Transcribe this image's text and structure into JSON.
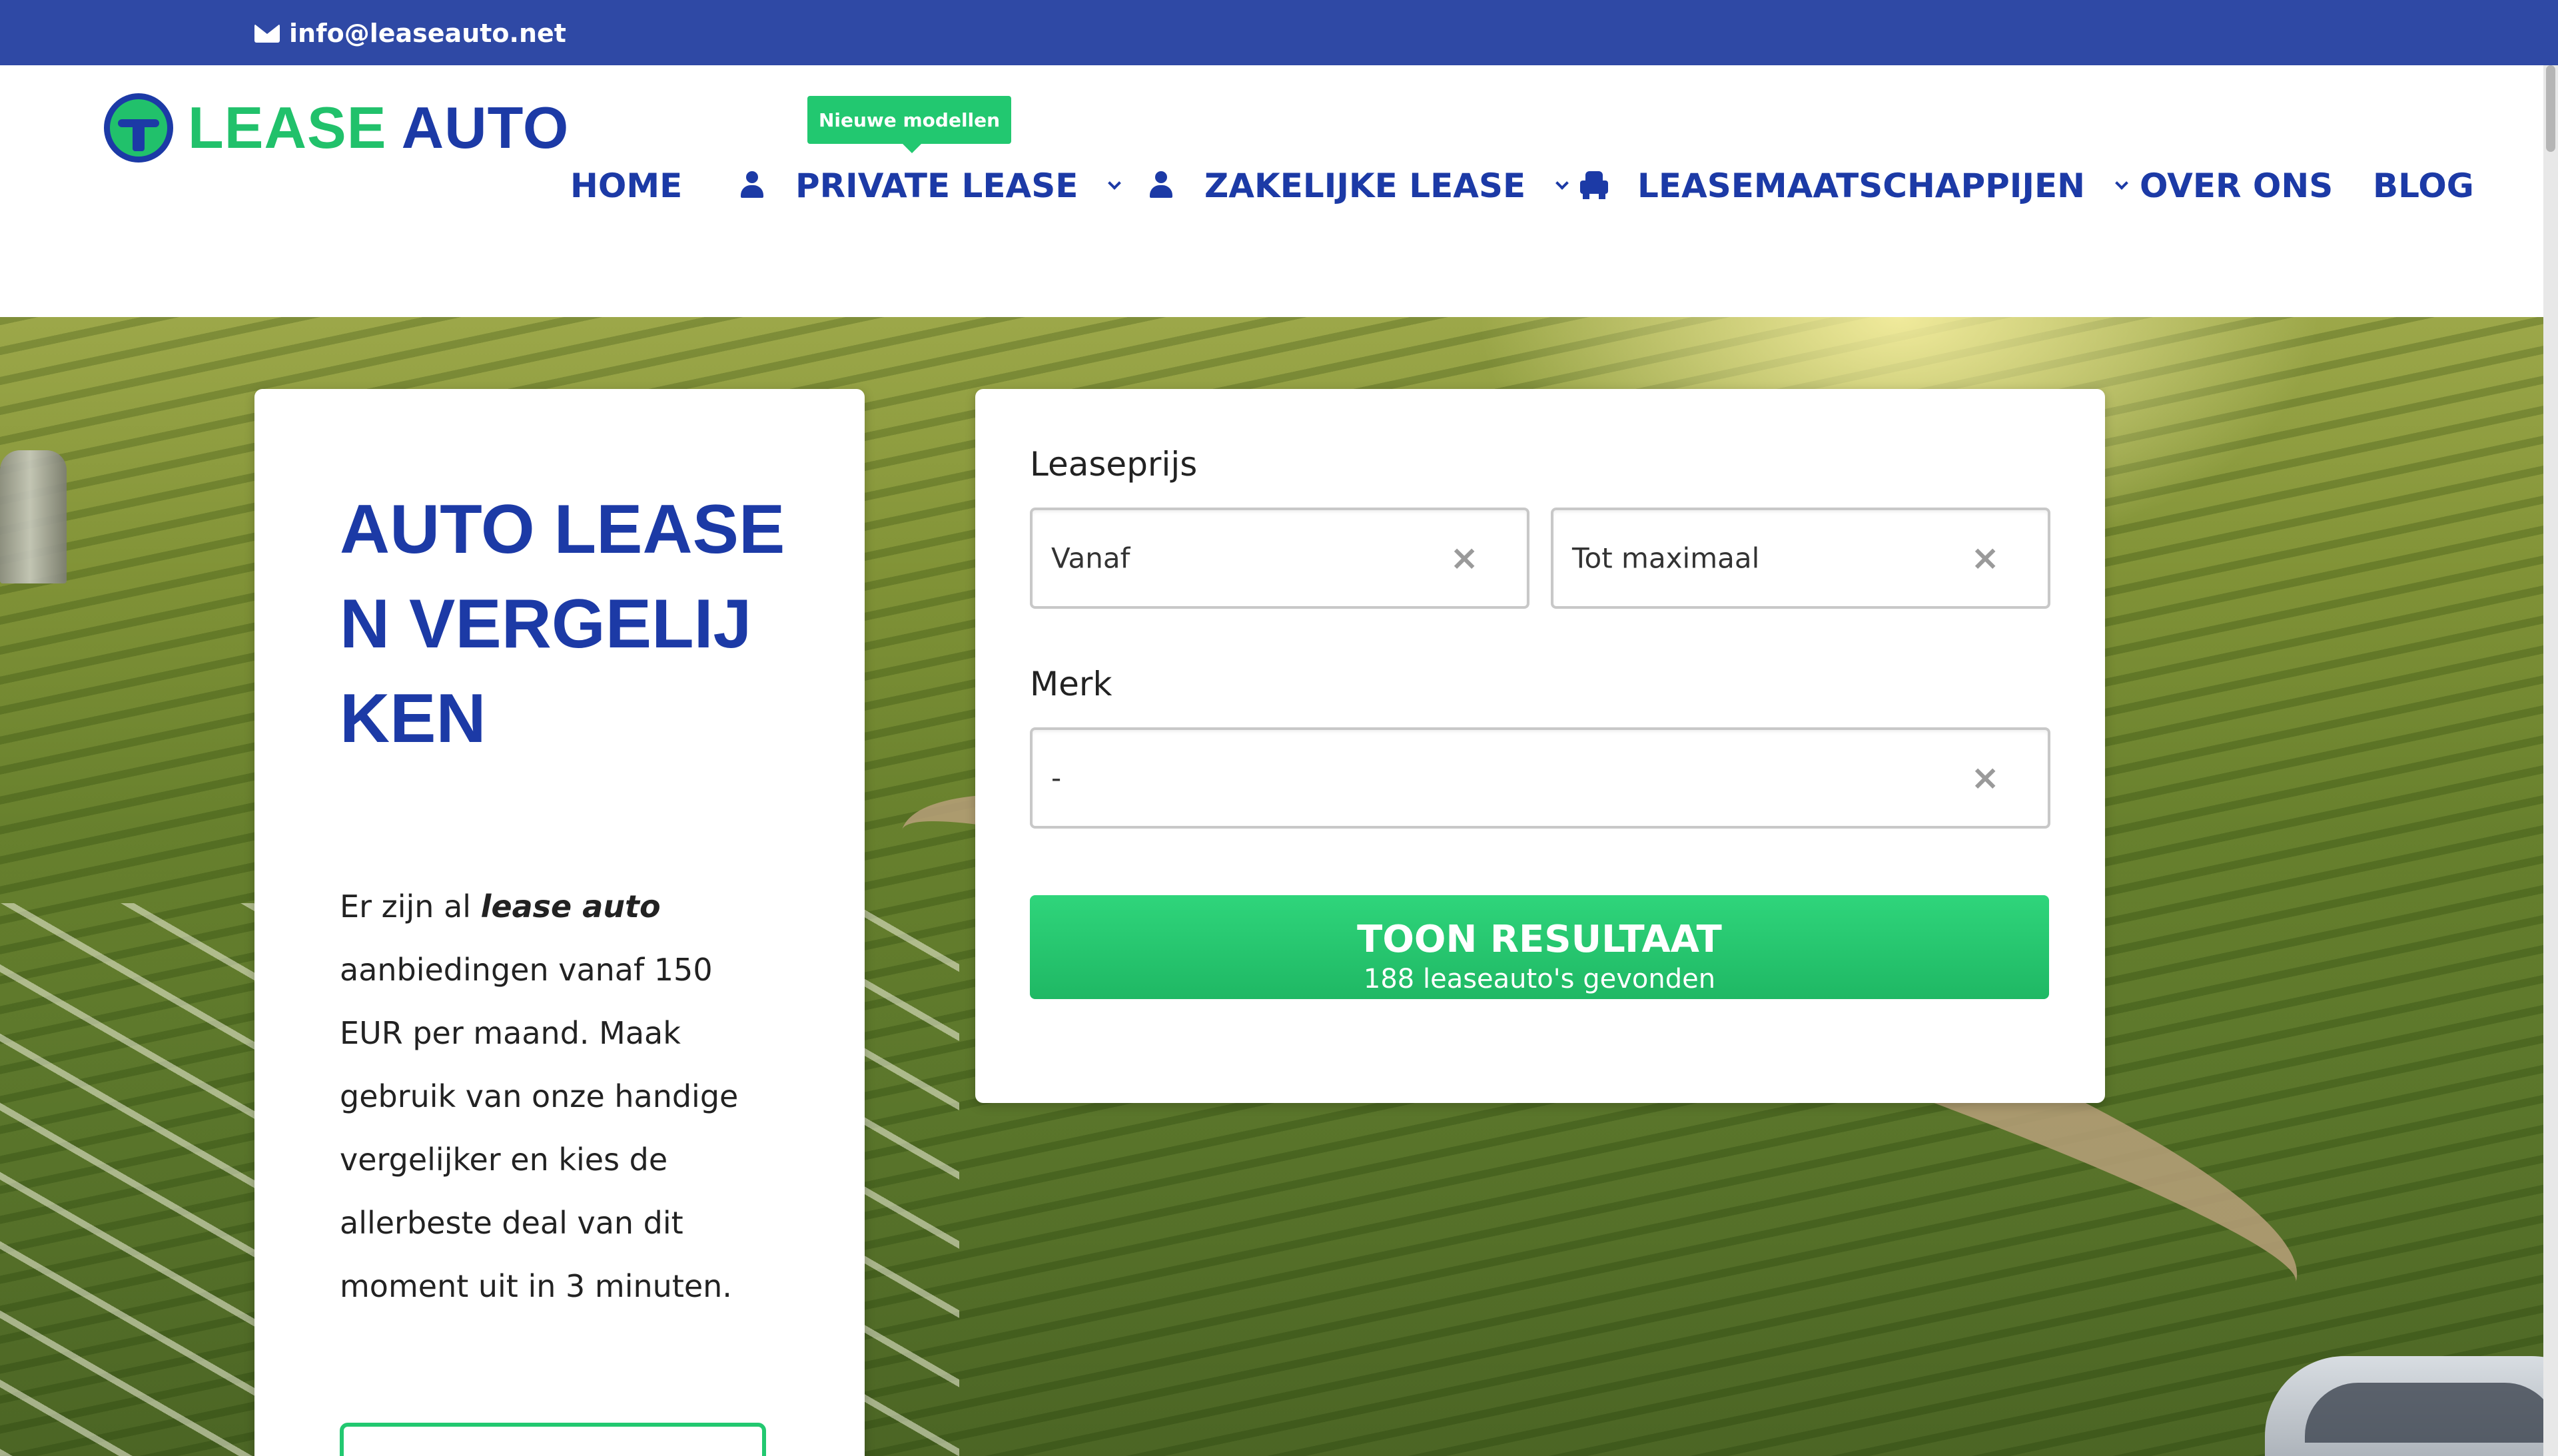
{
  "topbar": {
    "email": "info@leaseauto.net"
  },
  "logo": {
    "part1": "LEASE",
    "part2": "AUTO"
  },
  "nav": {
    "badge": "Nieuwe modellen",
    "items": [
      {
        "label": "HOME"
      },
      {
        "label": "PRIVATE LEASE",
        "icon": "person-icon",
        "dropdown": true
      },
      {
        "label": "ZAKELIJKE LEASE",
        "icon": "person-tie-icon",
        "dropdown": true
      },
      {
        "label": "LEASEMAATSCHAPPIJEN",
        "icon": "car-icon",
        "dropdown": true
      },
      {
        "label": "OVER ONS"
      },
      {
        "label": "BLOG"
      }
    ]
  },
  "hero": {
    "title": "AUTO LEASEN VERGELIJKEN",
    "text_before": "Er zijn al ",
    "text_em": "lease auto",
    "text_after": " aanbiedingen vanaf 150 EUR per maand. Maak gebruik van onze handige vergelijker en kies de allerbeste deal van dit moment uit in 3 minuten."
  },
  "search": {
    "price_label": "Leaseprijs",
    "from_value": "Vanaf",
    "to_value": "Tot maximaal",
    "brand_label": "Merk",
    "brand_value": "-",
    "clear_symbol": "×",
    "button_label": "TOON RESULTAAT",
    "button_sub": "188 leaseauto's gevonden"
  },
  "colors": {
    "brand_blue": "#1c3aa6",
    "brand_green": "#21c16b",
    "topbar": "#2f49a5"
  }
}
